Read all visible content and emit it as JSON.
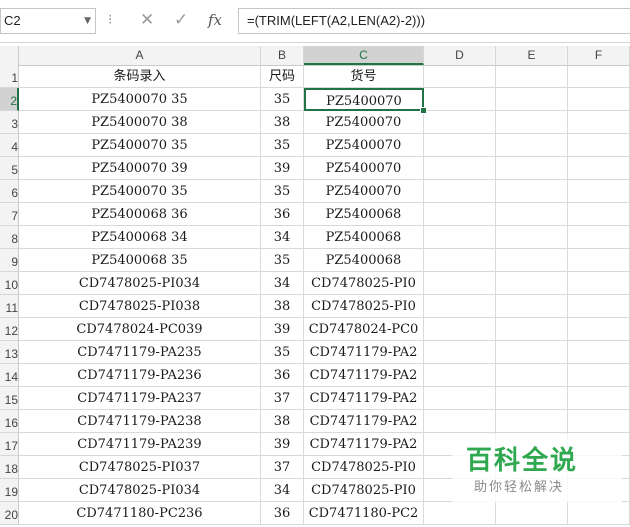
{
  "formula_bar": {
    "name_box": "C2",
    "name_box_arrow": "▼",
    "separator": "⁝",
    "cancel_icon": "✕",
    "enter_icon": "✓",
    "fx_label": "fx",
    "formula": "=(TRIM(LEFT(A2,LEN(A2)-2)))"
  },
  "columns": [
    "A",
    "B",
    "C",
    "D",
    "E",
    "F"
  ],
  "selected_cell": "C2",
  "header_row": {
    "num": "1",
    "a": "条码录入",
    "b": "尺码",
    "c": "货号"
  },
  "rows": [
    {
      "num": "2",
      "a": "PZ5400070 35",
      "b": "35",
      "c": "PZ5400070"
    },
    {
      "num": "3",
      "a": "PZ5400070 38",
      "b": "38",
      "c": "PZ5400070"
    },
    {
      "num": "4",
      "a": "PZ5400070 35",
      "b": "35",
      "c": "PZ5400070"
    },
    {
      "num": "5",
      "a": "PZ5400070 39",
      "b": "39",
      "c": "PZ5400070"
    },
    {
      "num": "6",
      "a": "PZ5400070 35",
      "b": "35",
      "c": "PZ5400070"
    },
    {
      "num": "7",
      "a": "PZ5400068 36",
      "b": "36",
      "c": "PZ5400068"
    },
    {
      "num": "8",
      "a": "PZ5400068 34",
      "b": "34",
      "c": "PZ5400068"
    },
    {
      "num": "9",
      "a": "PZ5400068 35",
      "b": "35",
      "c": "PZ5400068"
    },
    {
      "num": "10",
      "a": "CD7478025-PI034",
      "b": "34",
      "c": "CD7478025-PI0"
    },
    {
      "num": "11",
      "a": "CD7478025-PI038",
      "b": "38",
      "c": "CD7478025-PI0"
    },
    {
      "num": "12",
      "a": "CD7478024-PC039",
      "b": "39",
      "c": "CD7478024-PC0"
    },
    {
      "num": "13",
      "a": "CD7471179-PA235",
      "b": "35",
      "c": "CD7471179-PA2"
    },
    {
      "num": "14",
      "a": "CD7471179-PA236",
      "b": "36",
      "c": "CD7471179-PA2"
    },
    {
      "num": "15",
      "a": "CD7471179-PA237",
      "b": "37",
      "c": "CD7471179-PA2"
    },
    {
      "num": "16",
      "a": "CD7471179-PA238",
      "b": "38",
      "c": "CD7471179-PA2"
    },
    {
      "num": "17",
      "a": "CD7471179-PA239",
      "b": "39",
      "c": "CD7471179-PA2"
    },
    {
      "num": "18",
      "a": "CD7478025-PI037",
      "b": "37",
      "c": "CD7478025-PI0"
    },
    {
      "num": "19",
      "a": "CD7478025-PI034",
      "b": "34",
      "c": "CD7478025-PI0"
    },
    {
      "num": "20",
      "a": "CD7471180-PC236",
      "b": "36",
      "c": "CD7471180-PC2"
    }
  ],
  "watermark": {
    "title": "百科全说",
    "subtitle": "助你轻松解决"
  },
  "colors": {
    "accent": "#217346",
    "watermark_green": "#2fa84f"
  }
}
